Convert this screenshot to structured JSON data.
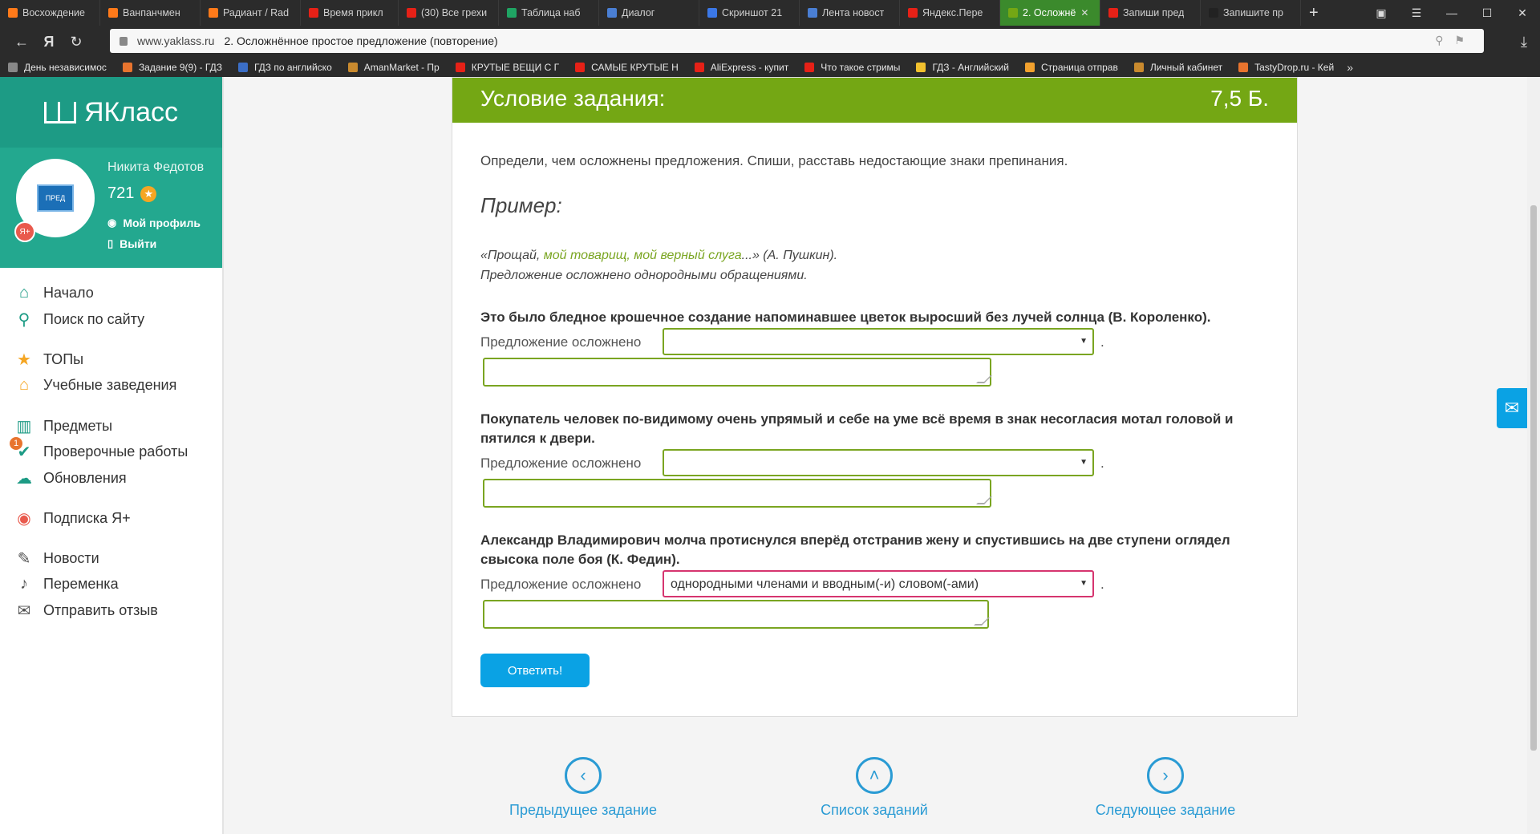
{
  "browser": {
    "tabs": [
      {
        "label": "Восхождение",
        "color": "#ff7a1a"
      },
      {
        "label": "Ванпанчмен",
        "color": "#ff7a1a"
      },
      {
        "label": "Радиант / Rad",
        "color": "#ff7a1a"
      },
      {
        "label": "Время прикл",
        "color": "#e62117"
      },
      {
        "label": "(30) Все грехи",
        "color": "#e62117"
      },
      {
        "label": "Таблица наб",
        "color": "#1fa463"
      },
      {
        "label": "Диалог",
        "color": "#4a7fd4"
      },
      {
        "label": "Скриншот 21",
        "color": "#3b78e7"
      },
      {
        "label": "Лента новост",
        "color": "#4a7fd4"
      },
      {
        "label": "Яндекс.Пере",
        "color": "#e62117"
      },
      {
        "label": "2. Осложнё",
        "color": "#74a714",
        "active": true,
        "close": "✕"
      },
      {
        "label": "Запиши пред",
        "color": "#e62117"
      },
      {
        "label": "Запишите пр",
        "color": "#222222"
      }
    ],
    "new_tab": "+",
    "address": {
      "domain": "www.yaklass.ru",
      "title": "2. Осложнённое простое предложение (повторение)"
    },
    "bookmarks": [
      {
        "label": "День независимос",
        "color": "#888888"
      },
      {
        "label": "Задание 9(9) - ГДЗ",
        "color": "#e8742e"
      },
      {
        "label": "ГДЗ по английско",
        "color": "#3b6ec6"
      },
      {
        "label": "AmanMarket - Пр",
        "color": "#c98a2e"
      },
      {
        "label": "КРУТЫЕ ВЕЩИ С Г",
        "color": "#e62117"
      },
      {
        "label": "САМЫЕ КРУТЫЕ Н",
        "color": "#e62117"
      },
      {
        "label": "AliExpress - купит",
        "color": "#e62117"
      },
      {
        "label": "Что такое стримы",
        "color": "#e62117"
      },
      {
        "label": "ГДЗ - Английский",
        "color": "#f2c12e"
      },
      {
        "label": "Страница отправ",
        "color": "#f2a12e"
      },
      {
        "label": "Личный кабинет",
        "color": "#c98a2e"
      },
      {
        "label": "TastyDrop.ru - Кей",
        "color": "#e8742e"
      }
    ]
  },
  "sidebar": {
    "logo": "ЯКласс",
    "user_name": "Никита Федотов",
    "score": "721",
    "my_profile": "Мой профиль",
    "logout": "Выйти",
    "avatar_text": "ПРЕД",
    "ya_plus": "Я+",
    "items": [
      {
        "label": "Начало",
        "icon": "home-icon",
        "color": "#1d9b85"
      },
      {
        "label": "Поиск по сайту",
        "icon": "search-icon",
        "color": "#1d9b85"
      },
      {
        "label": "ТОПы",
        "icon": "star-icon",
        "color": "#f5a623"
      },
      {
        "label": "Учебные заведения",
        "icon": "school-icon",
        "color": "#f5a623"
      },
      {
        "label": "Предметы",
        "icon": "books-icon",
        "color": "#1d9b85"
      },
      {
        "label": "Проверочные работы",
        "icon": "check-icon",
        "color": "#1d9b85",
        "badge": "1"
      },
      {
        "label": "Обновления",
        "icon": "cloud-icon",
        "color": "#1d9b85"
      },
      {
        "label": "Подписка Я+",
        "icon": "ya-plus-icon",
        "color": "#e95a4d"
      },
      {
        "label": "Новости",
        "icon": "thumbs-icon",
        "color": "#555555"
      },
      {
        "label": "Переменка",
        "icon": "bell-icon",
        "color": "#555555"
      },
      {
        "label": "Отправить отзыв",
        "icon": "feedback-icon",
        "color": "#555555"
      }
    ]
  },
  "task": {
    "header": "Условие задания:",
    "points": "7,5 Б.",
    "instruction": "Определи, чем осложнены предложения. Спиши, расставь недостающие знаки препинания.",
    "example_title": "Пример:",
    "example_line1_pre": "«Прощай, ",
    "example_line1_hl": "мой товарищ, мой верный слуга",
    "example_line1_post": "...» (А. Пушкин).",
    "example_line2": "Предложение осложнено однородными обращениями.",
    "label": "Предложение осложнено",
    "questions": [
      {
        "text": "Это было бледное крошечное создание напоминавшее цветок выросший без лучей солнца (В. Короленко).",
        "selected": ""
      },
      {
        "text": "Покупатель человек по-видимому очень упрямый и себе на уме всё время в знак несогласия мотал головой и пятился к двери.",
        "selected": ""
      },
      {
        "text": "Александр Владимирович молча протиснулся вперёд отстранив жену и спустившись на две ступени оглядел свысока поле боя (К. Федин).",
        "selected": "однородными членами и вводным(-и) словом(-ами)"
      }
    ],
    "answer_button": "Ответить!"
  },
  "bottom_nav": {
    "prev": "Предыдущее задание",
    "list": "Список заданий",
    "next": "Следующее задание"
  },
  "colors": {
    "accent_green": "#74a714",
    "brand_teal": "#1d9b85",
    "button_blue": "#0aa2e4",
    "link_blue": "#2a9bd4"
  }
}
